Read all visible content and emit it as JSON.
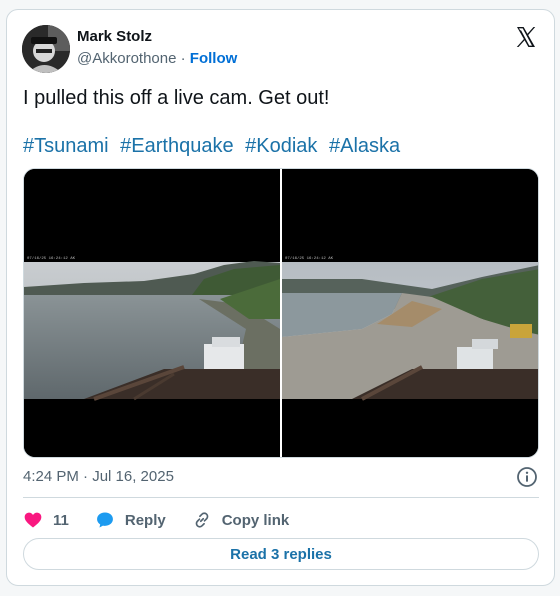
{
  "author": {
    "name": "Mark Stolz",
    "handle": "@Akkorothone",
    "separator": "·",
    "follow_label": "Follow"
  },
  "tweet": {
    "text": "I pulled this off a live cam. Get out!",
    "hashtags": [
      "#Tsunami",
      "#Earthquake",
      "#Kodiak",
      "#Alaska"
    ]
  },
  "media": {
    "left_cam_stamp": "07/16/25 16:24:12 AK",
    "right_cam_stamp": "07/16/25 16:24:12 AK"
  },
  "meta": {
    "timestamp": "4:24 PM · Jul 16, 2025"
  },
  "actions": {
    "likes": "11",
    "reply_label": "Reply",
    "copy_label": "Copy link"
  },
  "replies_button": "Read 3 replies",
  "colors": {
    "link": "#1b72a8",
    "heart": "#f91880",
    "reply_bubble": "#1d9bf0"
  }
}
